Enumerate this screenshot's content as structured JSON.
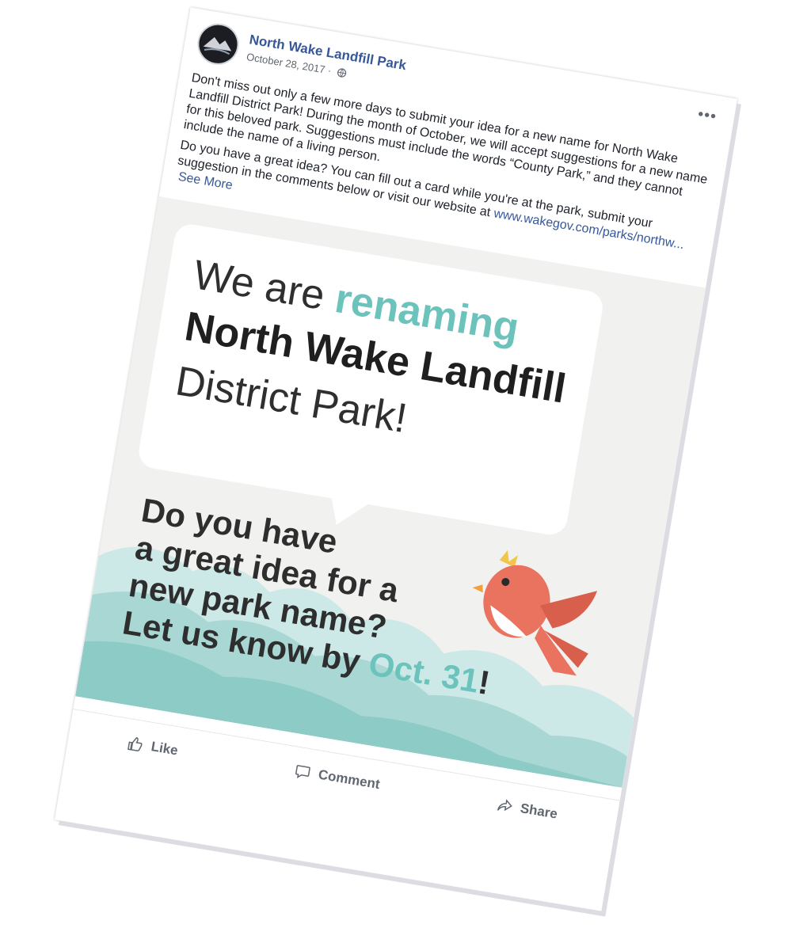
{
  "post": {
    "page_name": "North Wake Landfill Park",
    "date": "October 28, 2017 ·",
    "more_label": "•••",
    "paragraph_1": "Don't miss out only a few more days to submit your idea for a new name for North Wake Landfill District Park! During the month of October, we will accept suggestions for a new name for this beloved park. Suggestions must include the words “County Park,” and they cannot include the name of a living person.",
    "paragraph_2": "Do you have a great idea? You can fill out a card while you're at the park, submit your suggestion in the comments below or visit our website at",
    "link": "www.wakegov.com/parks/northw...",
    "see_more": "See More"
  },
  "graphic": {
    "line_we": "We are",
    "line_we_accent": "renaming",
    "line_name": "North Wake Landfill",
    "line_district": "District Park!",
    "q1": "Do you have",
    "q2": "a great idea for a",
    "q3": "new park name?",
    "q4": "Let us know by",
    "q4_accent": "Oct. 31",
    "q4_end": "!"
  },
  "actions": {
    "like": "Like",
    "comment": "Comment",
    "share": "Share"
  },
  "colors": {
    "link": "#365899",
    "accent_teal": "#6bc3bc",
    "bird": "#e9735f"
  }
}
